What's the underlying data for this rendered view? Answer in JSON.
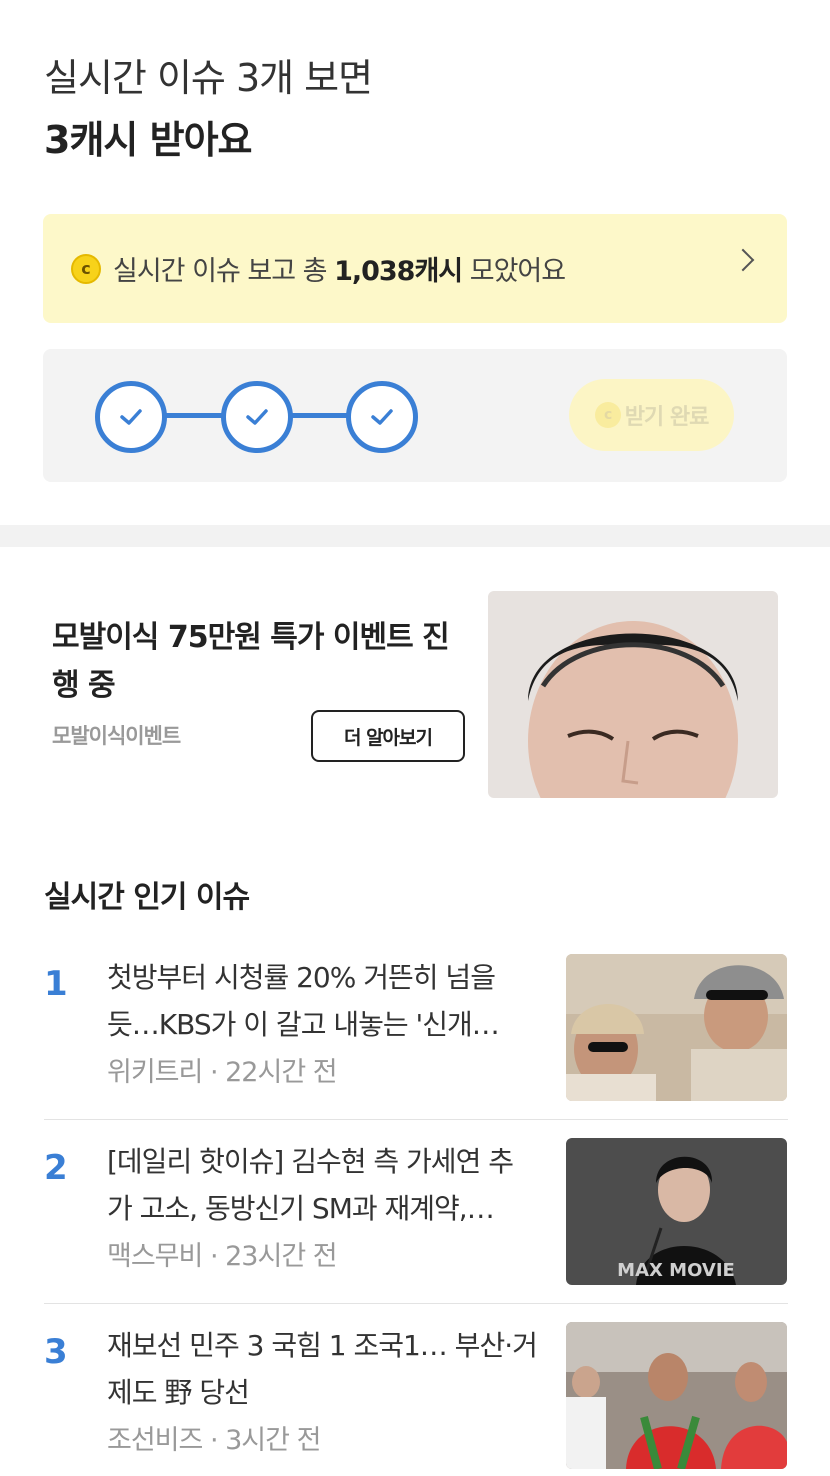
{
  "header": {
    "line1": "실시간 이슈 3개 보면",
    "line2_highlight": "3캐시",
    "line2_rest": " 받아요"
  },
  "summary": {
    "coin_icon": "c",
    "prefix": "실시간 이슈 보고 총 ",
    "amount": "1,038캐시",
    "suffix": " 모았어요"
  },
  "progress": {
    "steps_completed": 3,
    "steps_total": 3,
    "claim_coin": "c",
    "claim_label": "받기 완료"
  },
  "ad": {
    "title": "모발이식 75만원 특가 이벤트 진행 중",
    "brand": "모발이식이벤트",
    "button_label": "더 알아보기"
  },
  "issues": {
    "section_title": "실시간 인기 이슈",
    "items": [
      {
        "rank": "1",
        "title": "첫방부터 시청률 20% 거뜬히 넘을 듯…KBS가 이 갈고 내놓는 '신개…",
        "source": "위키트리",
        "time": "22시간 전",
        "separator": " · "
      },
      {
        "rank": "2",
        "title": "[데일리 핫이슈] 김수현 측 가세연 추가 고소, 동방신기 SM과 재계약,…",
        "source": "맥스무비",
        "time": "23시간 전",
        "separator": " · ",
        "watermark": "MAX MOVIE"
      },
      {
        "rank": "3",
        "title": "재보선 민주 3 국힘 1 조국1… 부산·거제도 野 당선",
        "source": "조선비즈",
        "time": "3시간 전",
        "separator": " · "
      }
    ]
  },
  "colors": {
    "accent": "#3a7fd5",
    "highlight": "#fde62f",
    "summary_bg": "#fdf8c9"
  }
}
